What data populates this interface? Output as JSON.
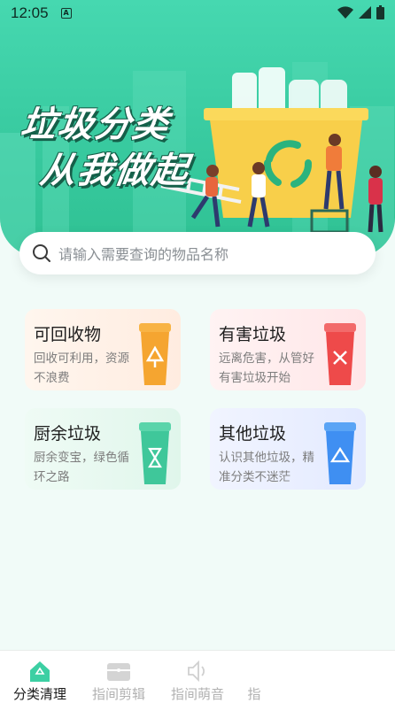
{
  "status_bar": {
    "time": "12:05"
  },
  "hero": {
    "title_line1": "垃圾分类",
    "title_line2": "从我做起"
  },
  "search": {
    "placeholder": "请输入需要查询的物品名称"
  },
  "categories": [
    {
      "title": "可回收物",
      "desc": "回收可利用，资源不浪费",
      "color": "#f5a530"
    },
    {
      "title": "有害垃圾",
      "desc": "远离危害，从管好有害垃圾开始",
      "color": "#ee4a4a"
    },
    {
      "title": "厨余垃圾",
      "desc": "厨余变宝，绿色循环之路",
      "color": "#3fc79a"
    },
    {
      "title": "其他垃圾",
      "desc": "认识其他垃圾，精准分类不迷茫",
      "color": "#3f8ff2"
    }
  ],
  "tabs": [
    {
      "label": "分类清理"
    },
    {
      "label": "指间剪辑"
    },
    {
      "label": "指间萌音"
    },
    {
      "label": "指"
    }
  ],
  "colors": {
    "accent": "#3ccfa3",
    "tab_active": "#1b1b1b",
    "tab_inactive": "#b1b1b1"
  }
}
